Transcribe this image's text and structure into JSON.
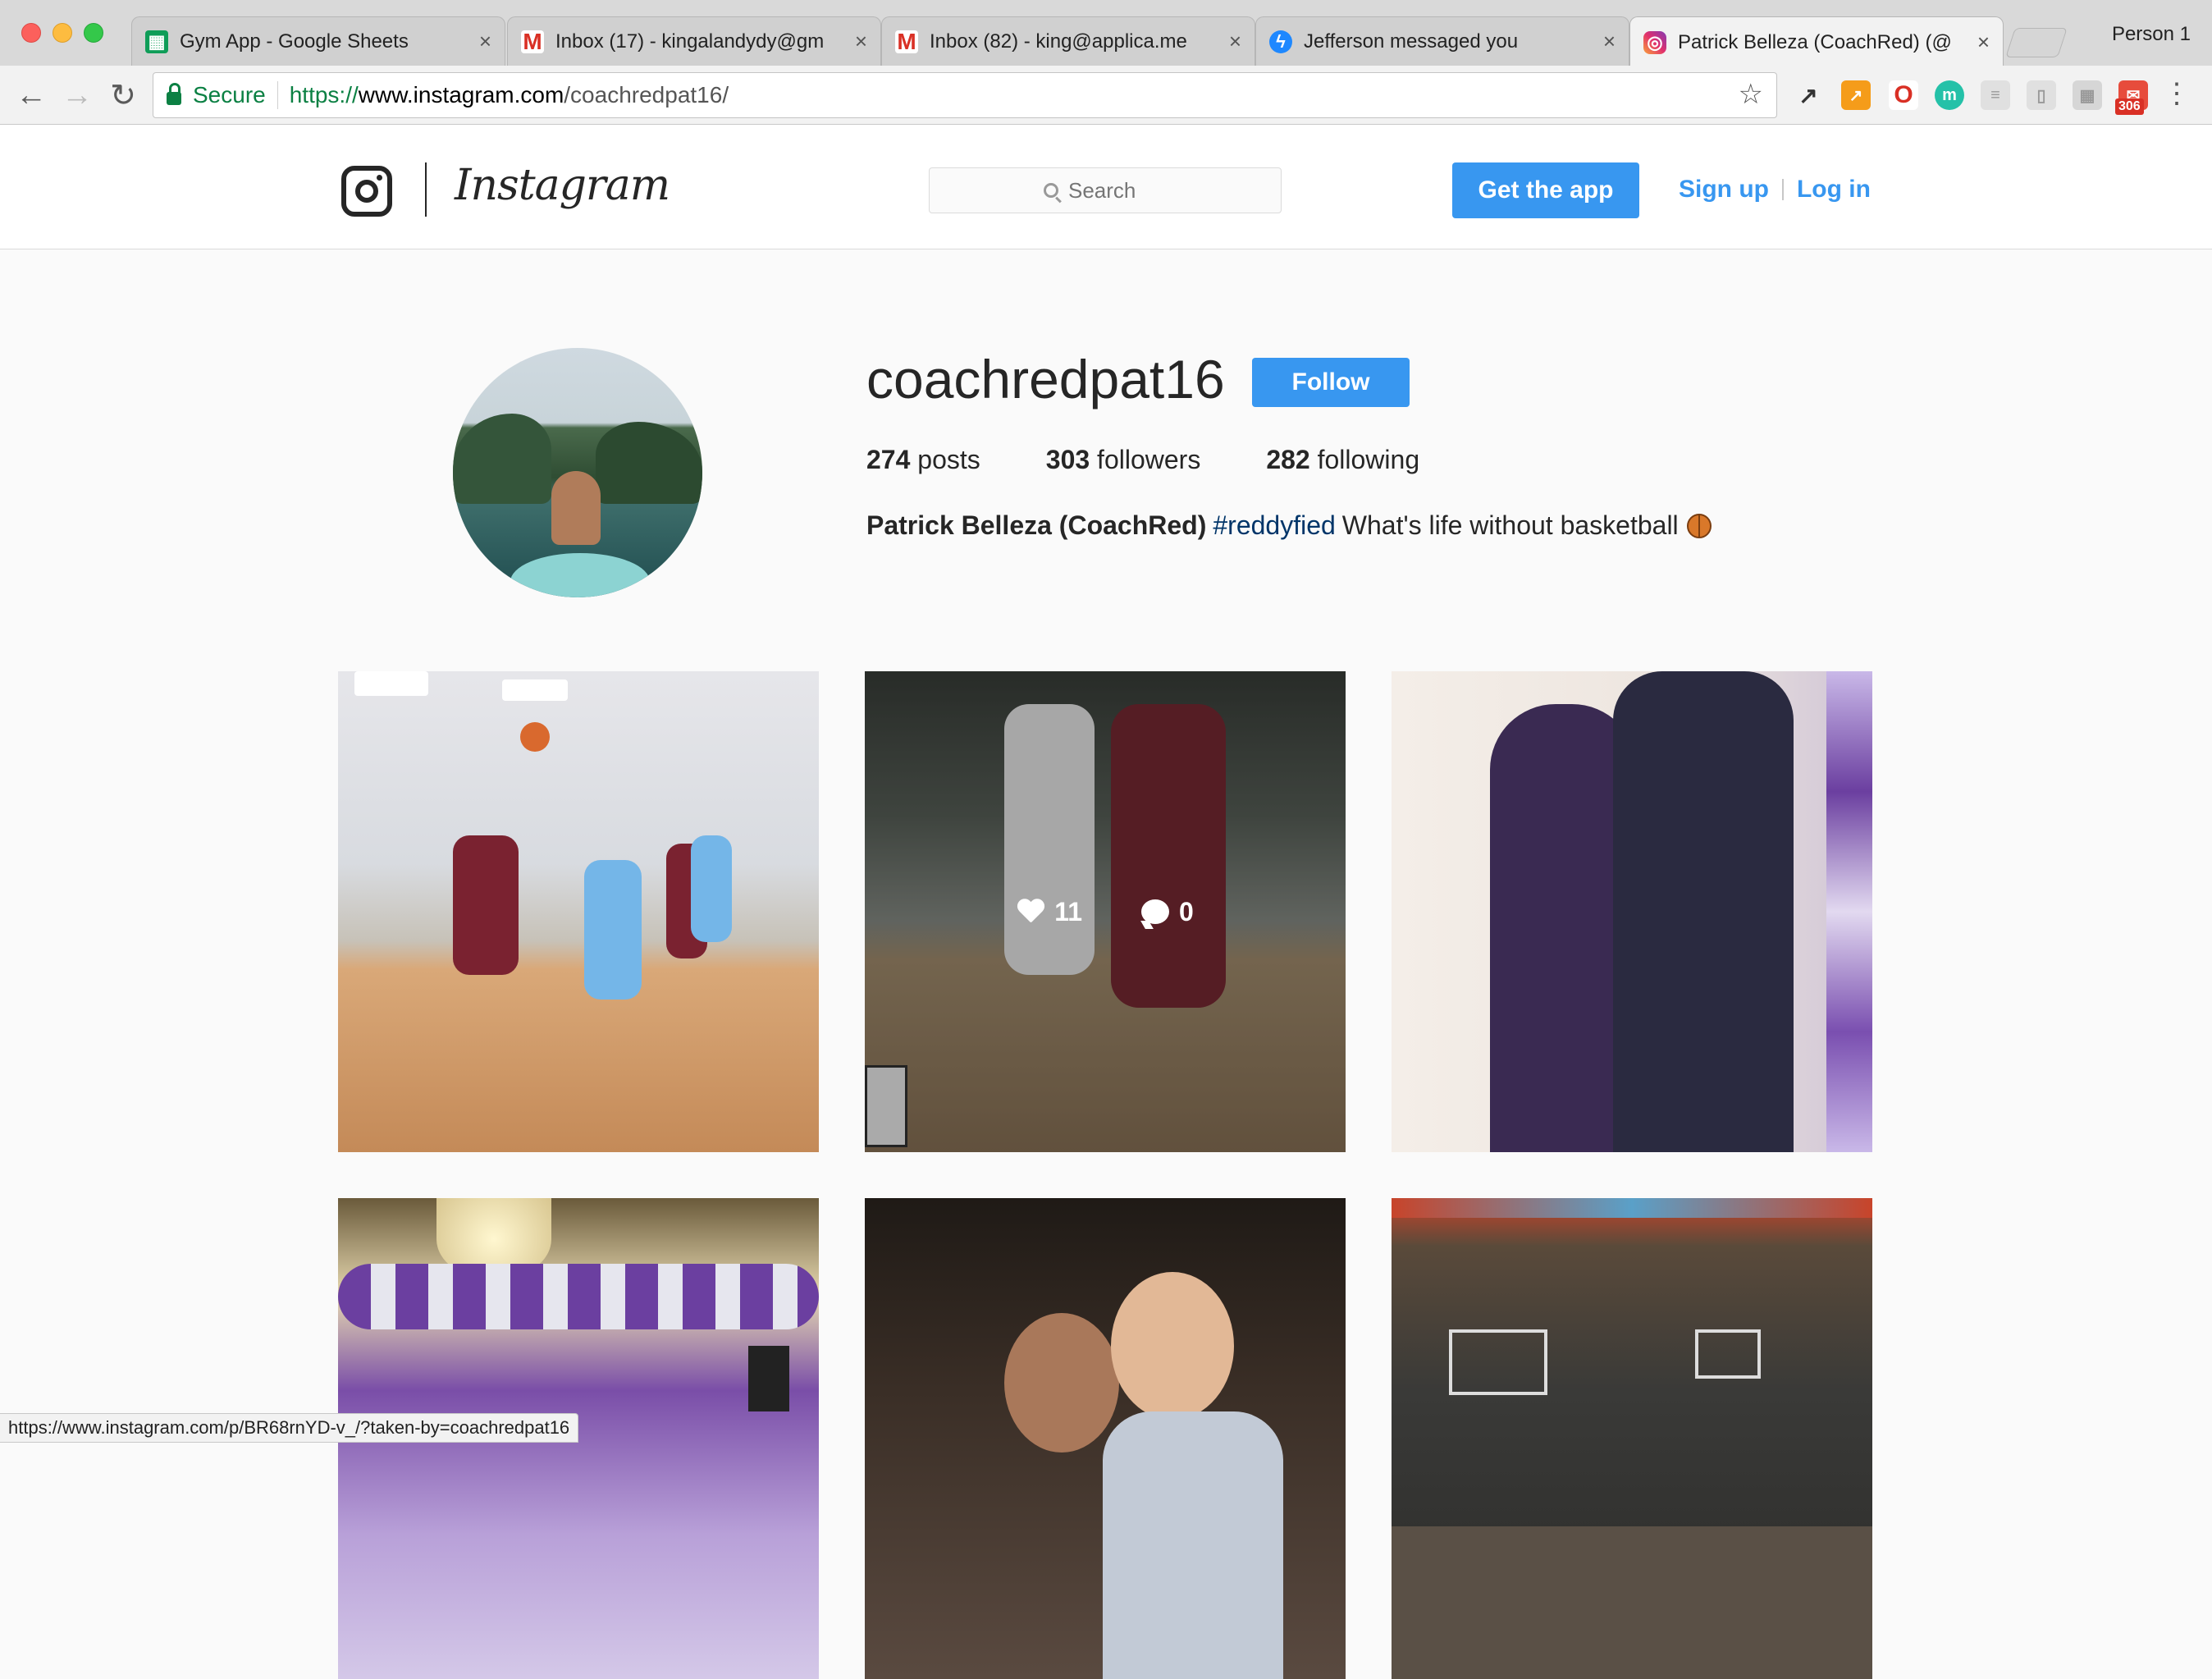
{
  "browser": {
    "tabs": [
      {
        "title": "Gym App - Google Sheets",
        "icon": "sheets-icon"
      },
      {
        "title": "Inbox (17) - kingalandydy@gm",
        "icon": "gmail-icon"
      },
      {
        "title": "Inbox (82) - king@applica.me",
        "icon": "gmail-icon"
      },
      {
        "title": "Jefferson messaged you",
        "icon": "messenger-icon"
      },
      {
        "title": "Patrick Belleza (CoachRed) (@",
        "icon": "instagram-icon"
      }
    ],
    "profile_label": "Person 1",
    "secure_label": "Secure",
    "url_scheme": "https://",
    "url_host": "www.instagram.com",
    "url_path": "/coachredpat16/",
    "extension_badge": "306",
    "status_url": "https://www.instagram.com/p/BR68rnYD-v_/?taken-by=coachredpat16"
  },
  "header": {
    "logo_text": "Instagram",
    "search_placeholder": "Search",
    "get_app_label": "Get the app",
    "sign_up_label": "Sign up",
    "log_in_label": "Log in"
  },
  "profile": {
    "username": "coachredpat16",
    "follow_label": "Follow",
    "posts_count": "274",
    "posts_label": "posts",
    "followers_count": "303",
    "followers_label": "followers",
    "following_count": "282",
    "following_label": "following",
    "full_name": "Patrick Belleza (CoachRed)",
    "hashtag": "#reddyfied",
    "bio_text": "What's life without basketball",
    "bio_icon": "basketball-icon"
  },
  "hover_post": {
    "likes": "11",
    "comments": "0"
  }
}
